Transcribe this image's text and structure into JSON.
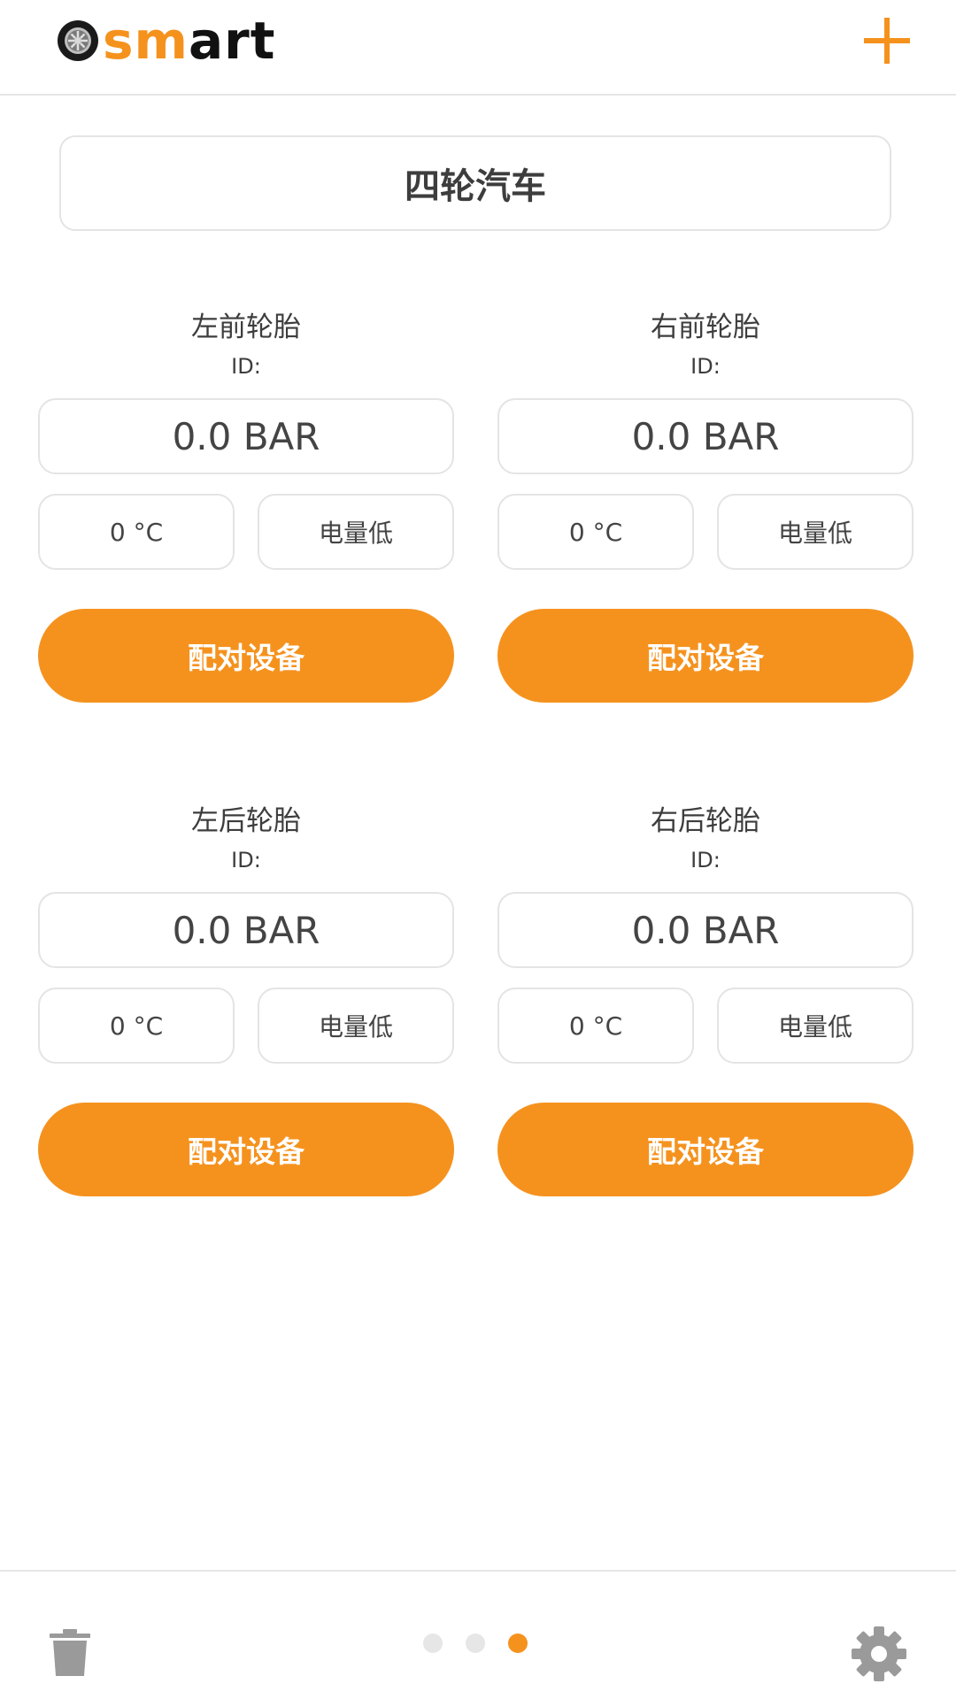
{
  "header": {
    "logo": {
      "letter_s": "s",
      "letter_m": "m",
      "letters_art": "art"
    },
    "add_icon": "plus-icon"
  },
  "title": "四轮汽车",
  "tires": [
    {
      "name": "左前轮胎",
      "id_label": "ID:",
      "pressure": "0.0 BAR",
      "temperature": "0 °C",
      "battery": "电量低",
      "pair_button": "配对设备"
    },
    {
      "name": "右前轮胎",
      "id_label": "ID:",
      "pressure": "0.0 BAR",
      "temperature": "0 °C",
      "battery": "电量低",
      "pair_button": "配对设备"
    },
    {
      "name": "左后轮胎",
      "id_label": "ID:",
      "pressure": "0.0 BAR",
      "temperature": "0 °C",
      "battery": "电量低",
      "pair_button": "配对设备"
    },
    {
      "name": "右后轮胎",
      "id_label": "ID:",
      "pressure": "0.0 BAR",
      "temperature": "0 °C",
      "battery": "电量低",
      "pair_button": "配对设备"
    }
  ],
  "footer": {
    "trash_icon": "trash-icon",
    "settings_icon": "gear-icon",
    "page_indicator": {
      "total": 3,
      "active": 3
    }
  },
  "colors": {
    "accent": "#f5921e",
    "border": "#e4e4e4",
    "text": "#3d3d3d",
    "icon_gray": "#9a9a9a"
  }
}
